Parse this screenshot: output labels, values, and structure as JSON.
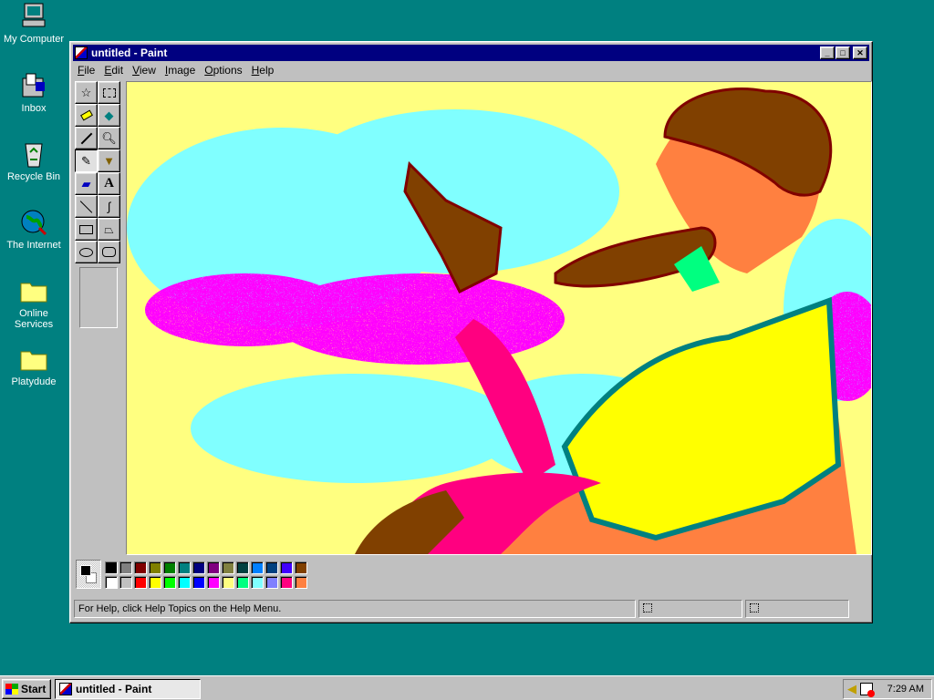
{
  "desktop": {
    "icons": [
      {
        "label": "My Computer"
      },
      {
        "label": "Inbox"
      },
      {
        "label": "Recycle Bin"
      },
      {
        "label": "The Internet"
      },
      {
        "label": "Online Services"
      },
      {
        "label": "Platydude"
      }
    ]
  },
  "window": {
    "title": "untitled - Paint",
    "menu": [
      "File",
      "Edit",
      "View",
      "Image",
      "Options",
      "Help"
    ]
  },
  "tools": [
    "free-form-select",
    "select",
    "eraser",
    "fill-with-color",
    "pick-color",
    "magnifier",
    "pencil",
    "brush",
    "airbrush",
    "text",
    "line",
    "curve",
    "rectangle",
    "polygon",
    "ellipse",
    "rounded-rectangle"
  ],
  "palette": {
    "top": [
      "#000000",
      "#808080",
      "#800000",
      "#808000",
      "#008000",
      "#008080",
      "#000080",
      "#800080",
      "#808040",
      "#004040",
      "#0080ff",
      "#004080",
      "#4000ff",
      "#804000"
    ],
    "bottom": [
      "#ffffff",
      "#c0c0c0",
      "#ff0000",
      "#ffff00",
      "#00ff00",
      "#00ffff",
      "#0000ff",
      "#ff00ff",
      "#ffff80",
      "#00ff80",
      "#80ffff",
      "#8080ff",
      "#ff0080",
      "#ff8040"
    ],
    "foreground": "#000000",
    "background": "#ffffff"
  },
  "status": {
    "help": "For Help, click Help Topics on the Help Menu."
  },
  "taskbar": {
    "start": "Start",
    "task": "untitled - Paint",
    "clock": "7:29 AM"
  }
}
